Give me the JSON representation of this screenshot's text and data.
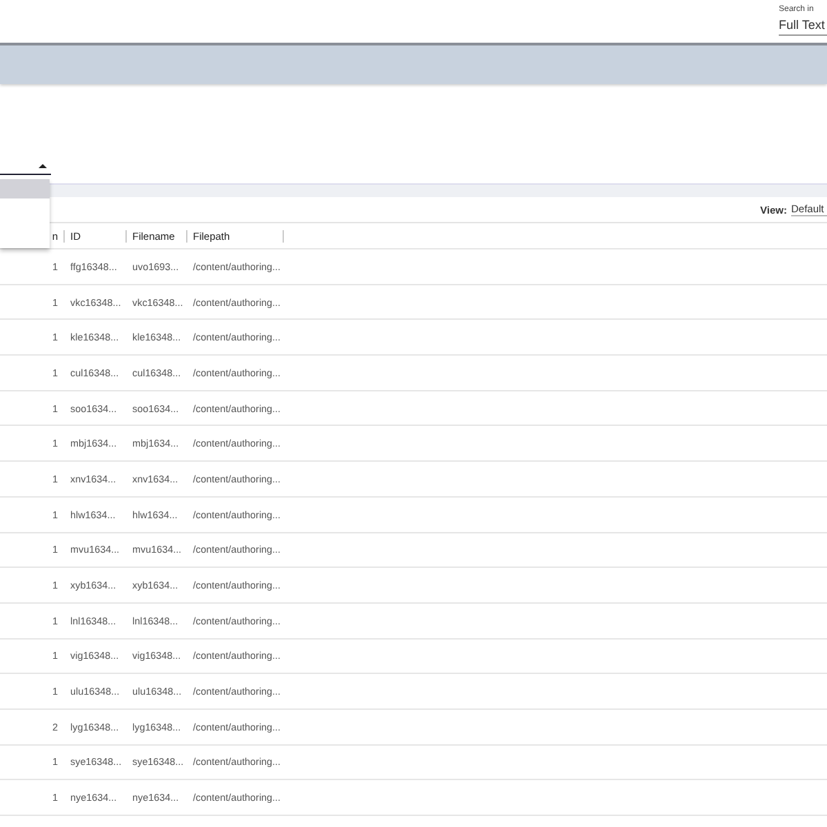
{
  "search_in": {
    "label": "Search in",
    "value": "Full Text"
  },
  "dropdown": {
    "expanded": true,
    "items": [
      {
        "selected": true
      }
    ]
  },
  "view": {
    "label": "View:",
    "value": "Default"
  },
  "table": {
    "columns": [
      "n",
      "ID",
      "Filename",
      "Filepath"
    ],
    "rows": [
      [
        "1",
        "ffg16348...",
        "uvo1693...",
        "/content/authoring..."
      ],
      [
        "1",
        "vkc16348...",
        "vkc16348...",
        "/content/authoring..."
      ],
      [
        "1",
        "kle16348...",
        "kle16348...",
        "/content/authoring..."
      ],
      [
        "1",
        "cul16348...",
        "cul16348...",
        "/content/authoring..."
      ],
      [
        "1",
        "soo1634...",
        "soo1634...",
        "/content/authoring..."
      ],
      [
        "1",
        "mbj1634...",
        "mbj1634...",
        "/content/authoring..."
      ],
      [
        "1",
        "xnv1634...",
        "xnv1634...",
        "/content/authoring..."
      ],
      [
        "1",
        "hlw1634...",
        "hlw1634...",
        "/content/authoring..."
      ],
      [
        "1",
        "mvu1634...",
        "mvu1634...",
        "/content/authoring..."
      ],
      [
        "1",
        "xyb1634...",
        "xyb1634...",
        "/content/authoring..."
      ],
      [
        "1",
        "lnl16348...",
        "lnl16348...",
        "/content/authoring..."
      ],
      [
        "1",
        "vig16348...",
        "vig16348...",
        "/content/authoring..."
      ],
      [
        "1",
        "ulu16348...",
        "ulu16348...",
        "/content/authoring..."
      ],
      [
        "2",
        "lyg16348...",
        "lyg16348...",
        "/content/authoring..."
      ],
      [
        "1",
        "sye16348...",
        "sye16348...",
        "/content/authoring..."
      ],
      [
        "1",
        "nye1634...",
        "nye1634...",
        "/content/authoring..."
      ]
    ]
  }
}
